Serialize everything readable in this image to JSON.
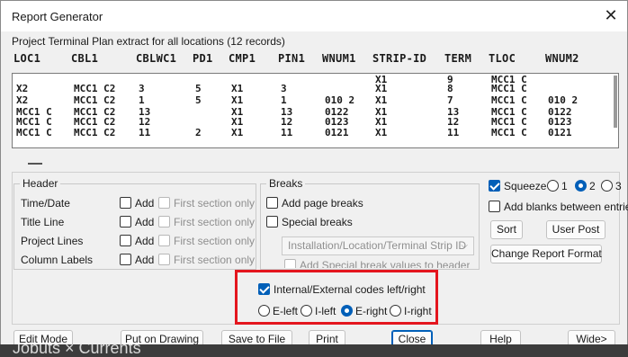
{
  "window": {
    "title": "Report Generator",
    "close_glyph": "✕"
  },
  "records_label": "Project Terminal Plan extract for all locations (12 records)",
  "columns": [
    "LOC1",
    "CBL1",
    "CBLWC1",
    "PD1",
    "CMP1",
    "PIN1",
    "WNUM1",
    "STRIP-ID",
    "TERM",
    "TLOC",
    "WNUM2"
  ],
  "rows": [
    [
      "",
      "",
      "",
      "",
      "",
      "",
      "",
      "X1",
      "9",
      "MCC1 C",
      ""
    ],
    [
      "X2",
      "MCC1 C2",
      "3",
      "5",
      "X1",
      "3",
      "",
      "X1",
      "8",
      "MCC1 C",
      ""
    ],
    [
      "X2",
      "MCC1 C2",
      "1",
      "5",
      "X1",
      "1",
      "010 2",
      "X1",
      "7",
      "MCC1 C",
      "010 2"
    ],
    [
      "MCC1 C",
      "MCC1 C2",
      "13",
      "",
      "X1",
      "13",
      "0122",
      "X1",
      "13",
      "MCC1 C",
      "0122"
    ],
    [
      "MCC1 C",
      "MCC1 C2",
      "12",
      "",
      "X1",
      "12",
      "0123",
      "X1",
      "12",
      "MCC1 C",
      "0123"
    ],
    [
      "MCC1 C",
      "MCC1 C2",
      "11",
      "2",
      "X1",
      "11",
      "0121",
      "X1",
      "11",
      "MCC1 C",
      "0121"
    ]
  ],
  "header_group": {
    "title": "Header",
    "items": [
      {
        "label": "Time/Date",
        "add": "Add",
        "first": "First section only"
      },
      {
        "label": "Title Line",
        "add": "Add",
        "first": "First section only"
      },
      {
        "label": "Project Lines",
        "add": "Add",
        "first": "First section only"
      },
      {
        "label": "Column Labels",
        "add": "Add",
        "first": "First section only"
      }
    ]
  },
  "breaks_group": {
    "title": "Breaks",
    "page_breaks": "Add page breaks",
    "special_breaks": "Special breaks",
    "combo_value": "Installation/Location/Terminal Strip ID",
    "add_special": "Add Special break values to header"
  },
  "squeeze": {
    "label": "Squeeze",
    "checked": true,
    "options": [
      "1",
      "2",
      "3"
    ],
    "selected": "2"
  },
  "add_blanks": "Add blanks between entries",
  "sort_label": "Sort",
  "user_post_label": "User Post",
  "change_format_label": "Change Report Format",
  "codes": {
    "label": "Internal/External codes left/right",
    "checked": true,
    "options": [
      "E-left",
      "I-left",
      "E-right",
      "I-right"
    ],
    "selected": "E-right"
  },
  "buttons": {
    "edit_mode": "Edit Mode",
    "put_on_drawing": "Put on Drawing",
    "save_to_file": "Save to File",
    "print": "Print",
    "close": "Close",
    "help": "Help",
    "wide": "Wide>"
  },
  "background_text": "Jobuts × Currents",
  "colors": {
    "accent": "#005fb8",
    "highlight": "#e4161e"
  }
}
